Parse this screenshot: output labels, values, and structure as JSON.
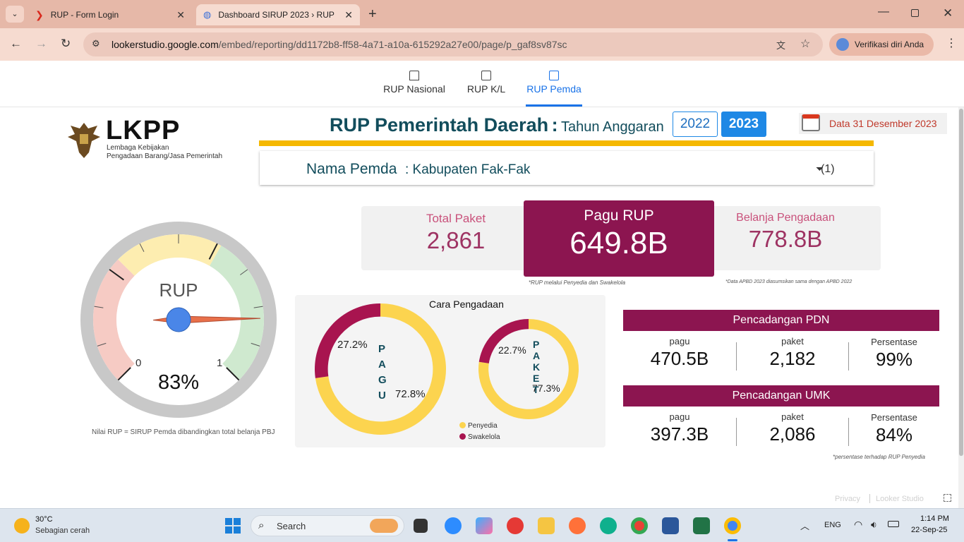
{
  "browser": {
    "tabs": [
      {
        "title": "RUP - Form Login"
      },
      {
        "title": "Dashboard SIRUP 2023 › RUP P..."
      }
    ],
    "url_domain": "lookerstudio.google.com",
    "url_path": "/embed/reporting/dd1172b8-ff58-4a71-a10a-615292a27e00/page/p_gaf8sv87sc",
    "profile_label": "Verifikasi diri Anda"
  },
  "report_nav": {
    "items": [
      {
        "label": "RUP Nasional"
      },
      {
        "label": "RUP K/L"
      },
      {
        "label": "RUP Pemda"
      }
    ]
  },
  "logo": {
    "wordmark": "LKPP",
    "line1": "Lembaga Kebijakan",
    "line2": "Pengadaan Barang/Jasa Pemerintah"
  },
  "header": {
    "title": "RUP Pemerintah Daerah",
    "colon": ":",
    "subtitle": "Tahun Anggaran",
    "year_2022": "2022",
    "year_2023": "2023",
    "data_date": "Data 31 Desember 2023"
  },
  "filter": {
    "label": "Nama Pemda",
    "value": ": Kabupaten Fak-Fak",
    "count": "(1)"
  },
  "gauge": {
    "title": "RUP",
    "min_label": "0",
    "max_label": "1",
    "value_label": "83%",
    "value": 0.83,
    "footnote": "Nilai RUP = SIRUP Pemda dibandingkan total belanja PBJ"
  },
  "kpis": {
    "total_paket_label": "Total Paket",
    "total_paket_value": "2,861",
    "pagu_label": "Pagu RUP",
    "pagu_value": "649.8B",
    "pagu_note": "*RUP melalui Penyedia dan Swakelola",
    "belanja_label": "Belanja Pengadaan",
    "belanja_value": "778.8B",
    "belanja_note": "*Data APBD 2023 diasumsikan sama dengan APBD 2022"
  },
  "cara_pengadaan": {
    "title": "Cara Pengadaan",
    "legend": [
      {
        "label": "Penyedia",
        "color": "#fcd44f"
      },
      {
        "label": "Swakelola",
        "color": "#a8144f"
      }
    ]
  },
  "chart_data": [
    {
      "type": "pie",
      "name": "PAGU",
      "label": "PAGU",
      "categories": [
        "Penyedia",
        "Swakelola"
      ],
      "values": [
        72.8,
        27.2
      ],
      "labels": [
        "72.8%",
        "27.2%"
      ],
      "colors": [
        "#fcd44f",
        "#a8144f"
      ]
    },
    {
      "type": "pie",
      "name": "PAKET",
      "label": "PAKET",
      "categories": [
        "Penyedia",
        "Swakelola"
      ],
      "values": [
        77.3,
        22.7
      ],
      "labels": [
        "77.3%",
        "22.7%"
      ],
      "colors": [
        "#fcd44f",
        "#a8144f"
      ]
    }
  ],
  "pdn": {
    "title": "Pencadangan PDN",
    "pagu_label": "pagu",
    "pagu_value": "470.5B",
    "paket_label": "paket",
    "paket_value": "2,182",
    "pct_label": "Persentase",
    "pct_value": "99%"
  },
  "umk": {
    "title": "Pencadangan UMK",
    "pagu_label": "pagu",
    "pagu_value": "397.3B",
    "paket_label": "paket",
    "paket_value": "2,086",
    "pct_label": "Persentase",
    "pct_value": "84%",
    "note": "*persentase terhadap RUP Penyedia"
  },
  "footer": {
    "privacy": "Privacy",
    "looker": "Looker Studio"
  },
  "taskbar": {
    "temp": "30°C",
    "weather": "Sebagian cerah",
    "search": "Search",
    "lang": "ENG",
    "time": "1:14 PM",
    "date": "22-Sep-25"
  },
  "colors": {
    "maroon": "#8c1550",
    "yellow": "#f5b800",
    "blue": "#1e88e5",
    "teal": "#124d5c"
  }
}
